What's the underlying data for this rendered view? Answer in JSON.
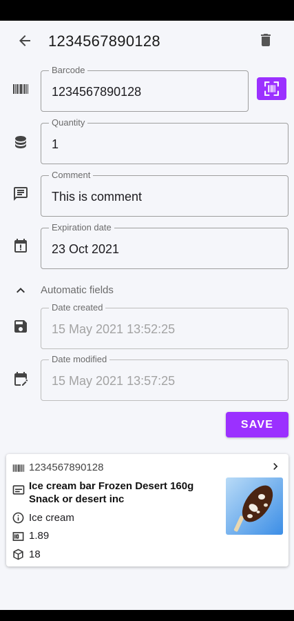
{
  "appbar": {
    "title": "1234567890128"
  },
  "form": {
    "barcode": {
      "label": "Barcode",
      "value": "1234567890128"
    },
    "quantity": {
      "label": "Quantity",
      "value": "1"
    },
    "comment": {
      "label": "Comment",
      "value": "This is comment"
    },
    "expiration": {
      "label": "Expiration date",
      "value": "23 Oct 2021"
    }
  },
  "automatic": {
    "section_label": "Automatic fields",
    "created": {
      "label": "Date created",
      "value": "15 May 2021 13:52:25"
    },
    "modified": {
      "label": "Date modified",
      "value": "15 May 2021 13:57:25"
    }
  },
  "save_label": "SAVE",
  "product_card": {
    "barcode": "1234567890128",
    "name": "Ice cream bar Frozen Desert 160g Snack or desert inc",
    "category": "Ice cream",
    "price": "1.89",
    "quantity": "18"
  },
  "colors": {
    "accent": "#9b30ff",
    "background": "#f5f6fa",
    "outline": "#9e9e9e"
  },
  "icons": [
    "back-arrow-icon",
    "delete-icon",
    "barcode-icon",
    "scan-icon",
    "database-icon",
    "comment-icon",
    "calendar-alert-icon",
    "chevron-up-icon",
    "save-icon",
    "edit-calendar-icon",
    "chevron-right-icon",
    "product-icon",
    "info-icon",
    "money-icon",
    "box-icon"
  ]
}
